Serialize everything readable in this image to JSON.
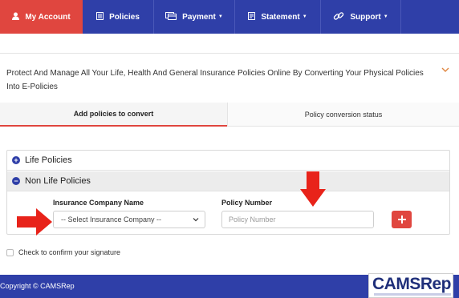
{
  "nav": {
    "items": [
      {
        "label": "My Account",
        "icon": "user-icon",
        "has_caret": false,
        "active": true
      },
      {
        "label": "Policies",
        "icon": "document-icon",
        "has_caret": false,
        "active": false
      },
      {
        "label": "Payment",
        "icon": "payment-icon",
        "has_caret": true,
        "active": false
      },
      {
        "label": "Statement",
        "icon": "statement-icon",
        "has_caret": true,
        "active": false
      },
      {
        "label": "Support",
        "icon": "link-icon",
        "has_caret": true,
        "active": false
      }
    ]
  },
  "intro": {
    "text": "Protect And Manage All Your Life, Health And General Insurance Policies Online By Converting Your Physical Policies Into E-Policies"
  },
  "tabs": {
    "add": "Add policies to convert",
    "status": "Policy conversion status"
  },
  "accordion": {
    "life": "Life Policies",
    "non_life": "Non Life Policies"
  },
  "form": {
    "company_label": "Insurance Company Name",
    "company_selected": "-- Select Insurance Company --",
    "policy_label": "Policy Number",
    "policy_placeholder": "Policy Number"
  },
  "signature": {
    "label": "Check to confirm your signature"
  },
  "footer": {
    "copyright": "Copyright © CAMSRep",
    "logo_text": "CAMSRep"
  },
  "colors": {
    "nav_blue": "#2f3fa8",
    "accent_red": "#e0463f"
  }
}
